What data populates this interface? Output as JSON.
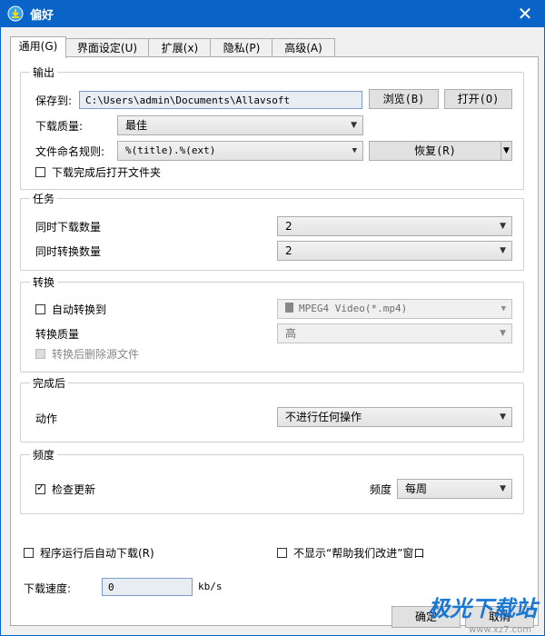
{
  "window": {
    "title": "偏好",
    "close_glyph": "✕"
  },
  "tabs": [
    "通用(G)",
    "界面设定(U)",
    "扩展(x)",
    "隐私(P)",
    "高级(A)"
  ],
  "output": {
    "title": "输出",
    "save_to_label": "保存到:",
    "save_path": "C:\\Users\\admin\\Documents\\Allavsoft",
    "browse_button": "浏览(B)",
    "open_button": "打开(O)",
    "quality_label": "下载质量:",
    "quality_value": "最佳",
    "naming_label": "文件命名规则:",
    "naming_value": "%(title).%(ext)",
    "restore_button": "恢复(R)",
    "open_folder_label": "下载完成后打开文件夹",
    "open_folder_checked": false
  },
  "task": {
    "title": "任务",
    "concurrent_download_label": "同时下载数量",
    "concurrent_download_value": "2",
    "concurrent_convert_label": "同时转换数量",
    "concurrent_convert_value": "2"
  },
  "convert": {
    "title": "转换",
    "auto_convert_label": "自动转换到",
    "auto_convert_checked": false,
    "format_value": "MPEG4 Video(*.mp4)",
    "quality_label": "转换质量",
    "quality_value": "高",
    "delete_source_label": "转换后删除源文件"
  },
  "after": {
    "title": "完成后",
    "action_label": "动作",
    "action_value": "不进行任何操作"
  },
  "frequency": {
    "title": "频度",
    "check_updates_label": "检查更新",
    "check_updates_checked": true,
    "freq_label": "频度",
    "freq_value": "每周"
  },
  "misc": {
    "auto_download_label": "程序运行后自动下载(R)",
    "no_help_label": "不显示“帮助我们改进”窗口",
    "speed_label": "下载速度:",
    "speed_value": "0",
    "speed_unit": "kb/s"
  },
  "footer": {
    "ok_button": "确定",
    "cancel_button": "取消"
  },
  "watermark": {
    "text": "极光下载站",
    "sub": "www.xz7.com"
  }
}
